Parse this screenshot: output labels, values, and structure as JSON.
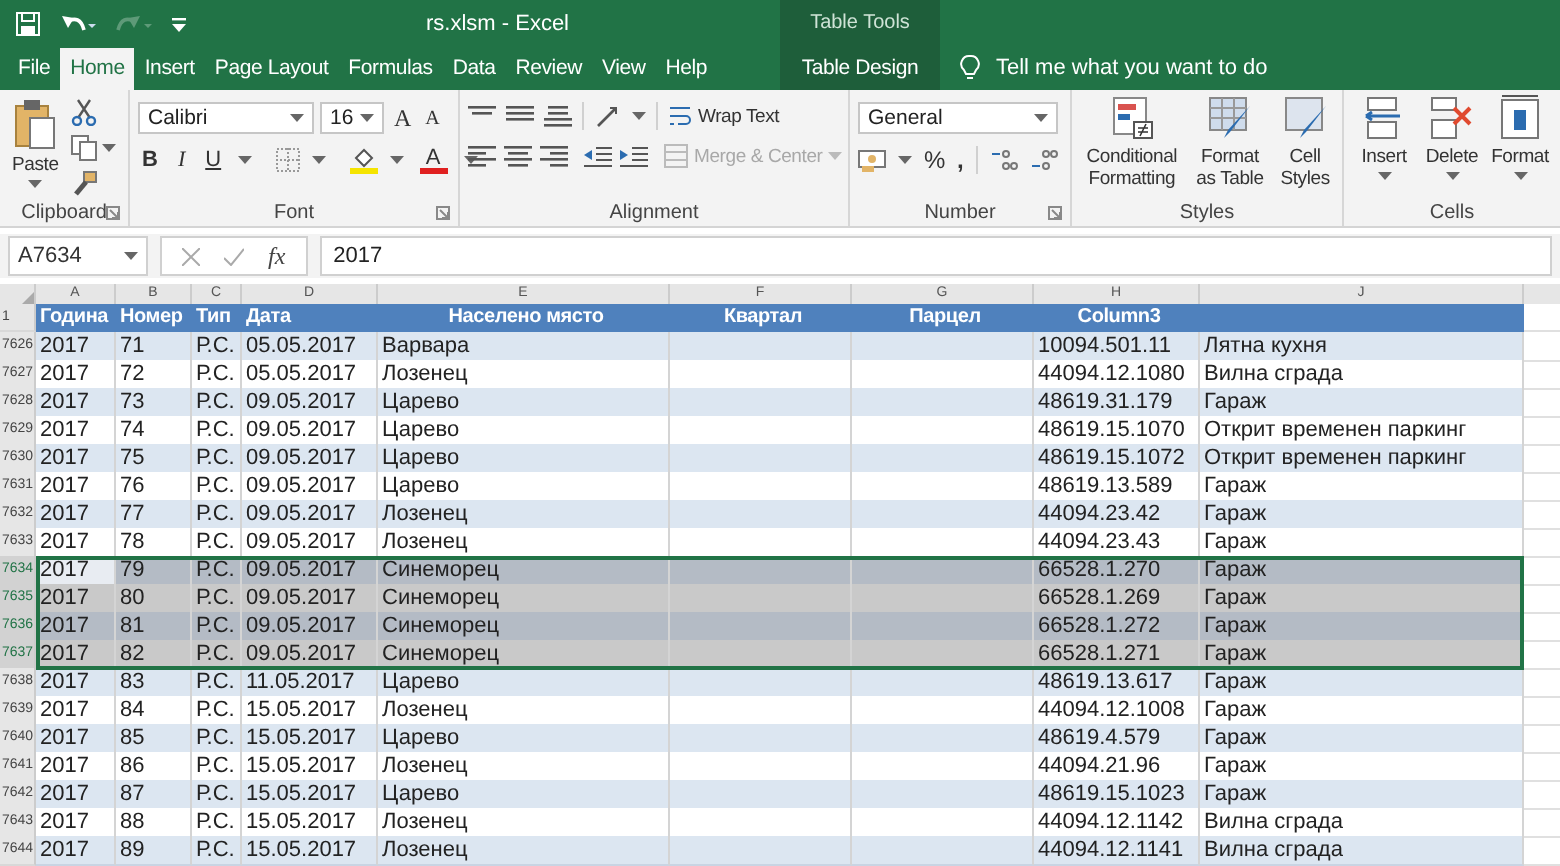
{
  "window": {
    "title": "rs.xlsm  -  Excel"
  },
  "context_tab_group": {
    "label": "Table Tools"
  },
  "tabs": [
    {
      "label": "File",
      "selected": false,
      "kind": "main"
    },
    {
      "label": "Home",
      "selected": true,
      "kind": "main"
    },
    {
      "label": "Insert",
      "selected": false,
      "kind": "main"
    },
    {
      "label": "Page Layout",
      "selected": false,
      "kind": "main"
    },
    {
      "label": "Formulas",
      "selected": false,
      "kind": "main"
    },
    {
      "label": "Data",
      "selected": false,
      "kind": "main"
    },
    {
      "label": "Review",
      "selected": false,
      "kind": "main"
    },
    {
      "label": "View",
      "selected": false,
      "kind": "main"
    },
    {
      "label": "Help",
      "selected": false,
      "kind": "main"
    },
    {
      "label": "Table Design",
      "selected": false,
      "kind": "contextual"
    }
  ],
  "tell_me": {
    "placeholder": "Tell me what you want to do"
  },
  "clipboard": {
    "label": "Clipboard",
    "paste": "Paste"
  },
  "font": {
    "label": "Font",
    "name": "Calibri",
    "size": "16",
    "grow": "A",
    "shrink": "A",
    "bold": "B",
    "italic": "I",
    "underline": "U",
    "font_color_button": "A"
  },
  "alignment": {
    "label": "Alignment",
    "wrap_text": "Wrap Text",
    "merge": {
      "label": "Merge & Center",
      "disabled": true
    }
  },
  "number": {
    "label": "Number",
    "format": "General",
    "percent": "%",
    "comma": ","
  },
  "styles": {
    "label": "Styles",
    "buttons": [
      "Conditional Formatting",
      "Format as Table",
      "Cell Styles"
    ]
  },
  "cells": {
    "label": "Cells",
    "buttons": [
      "Insert",
      "Delete",
      "Format"
    ]
  },
  "formula_bar": {
    "name_box": "A7634",
    "function_label": "fx",
    "value": "2017"
  },
  "column_letters": [
    "A",
    "B",
    "C",
    "D",
    "E",
    "F",
    "G",
    "H",
    "J"
  ],
  "header_row": {
    "row_number": "1",
    "cells": [
      "Година",
      "Номер",
      "Тип",
      "Дата",
      "Населено място",
      "Квартал",
      "Парцел",
      "Column3"
    ]
  },
  "rows": [
    {
      "row_number": "7626",
      "year": "2017",
      "number": "71",
      "type": "Р.С.",
      "date": "05.05.2017",
      "place": "Варвара",
      "column3": "10094.501.11",
      "column_j": "Лятна кухня",
      "selected": false
    },
    {
      "row_number": "7627",
      "year": "2017",
      "number": "72",
      "type": "Р.С.",
      "date": "05.05.2017",
      "place": "Лозенец",
      "column3": "44094.12.1080",
      "column_j": "Вилна сграда",
      "selected": false
    },
    {
      "row_number": "7628",
      "year": "2017",
      "number": "73",
      "type": "Р.С.",
      "date": "09.05.2017",
      "place": "Царево",
      "column3": "48619.31.179",
      "column_j": "Гараж",
      "selected": false
    },
    {
      "row_number": "7629",
      "year": "2017",
      "number": "74",
      "type": "Р.С.",
      "date": "09.05.2017",
      "place": "Царево",
      "column3": "48619.15.1070",
      "column_j": "Открит временен паркинг",
      "selected": false
    },
    {
      "row_number": "7630",
      "year": "2017",
      "number": "75",
      "type": "Р.С.",
      "date": "09.05.2017",
      "place": "Царево",
      "column3": "48619.15.1072",
      "column_j": "Открит временен паркинг",
      "selected": false
    },
    {
      "row_number": "7631",
      "year": "2017",
      "number": "76",
      "type": "Р.С.",
      "date": "09.05.2017",
      "place": "Царево",
      "column3": "48619.13.589",
      "column_j": "Гараж",
      "selected": false
    },
    {
      "row_number": "7632",
      "year": "2017",
      "number": "77",
      "type": "Р.С.",
      "date": "09.05.2017",
      "place": "Лозенец",
      "column3": "44094.23.42",
      "column_j": "Гараж",
      "selected": false
    },
    {
      "row_number": "7633",
      "year": "2017",
      "number": "78",
      "type": "Р.С.",
      "date": "09.05.2017",
      "place": "Лозенец",
      "column3": "44094.23.43",
      "column_j": "Гараж",
      "selected": false
    },
    {
      "row_number": "7634",
      "year": "2017",
      "number": "79",
      "type": "Р.С.",
      "date": "09.05.2017",
      "place": "Синеморец",
      "column3": "66528.1.270",
      "column_j": "Гараж",
      "selected": true
    },
    {
      "row_number": "7635",
      "year": "2017",
      "number": "80",
      "type": "Р.С.",
      "date": "09.05.2017",
      "place": "Синеморец",
      "column3": "66528.1.269",
      "column_j": "Гараж",
      "selected": true
    },
    {
      "row_number": "7636",
      "year": "2017",
      "number": "81",
      "type": "Р.С.",
      "date": "09.05.2017",
      "place": "Синеморец",
      "column3": "66528.1.272",
      "column_j": "Гараж",
      "selected": true
    },
    {
      "row_number": "7637",
      "year": "2017",
      "number": "82",
      "type": "Р.С.",
      "date": "09.05.2017",
      "place": "Синеморец",
      "column3": "66528.1.271",
      "column_j": "Гараж",
      "selected": true
    },
    {
      "row_number": "7638",
      "year": "2017",
      "number": "83",
      "type": "Р.С.",
      "date": "11.05.2017",
      "place": "Царево",
      "column3": "48619.13.617",
      "column_j": "Гараж",
      "selected": false
    },
    {
      "row_number": "7639",
      "year": "2017",
      "number": "84",
      "type": "Р.С.",
      "date": "15.05.2017",
      "place": "Лозенец",
      "column3": "44094.12.1008",
      "column_j": "Гараж",
      "selected": false
    },
    {
      "row_number": "7640",
      "year": "2017",
      "number": "85",
      "type": "Р.С.",
      "date": "15.05.2017",
      "place": "Царево",
      "column3": "48619.4.579",
      "column_j": "Гараж",
      "selected": false
    },
    {
      "row_number": "7641",
      "year": "2017",
      "number": "86",
      "type": "Р.С.",
      "date": "15.05.2017",
      "place": "Лозенец",
      "column3": "44094.21.96",
      "column_j": "Гараж",
      "selected": false
    },
    {
      "row_number": "7642",
      "year": "2017",
      "number": "87",
      "type": "Р.С.",
      "date": "15.05.2017",
      "place": "Царево",
      "column3": "48619.15.1023",
      "column_j": "Гараж",
      "selected": false
    },
    {
      "row_number": "7643",
      "year": "2017",
      "number": "88",
      "type": "Р.С.",
      "date": "15.05.2017",
      "place": "Лозенец",
      "column3": "44094.12.1142",
      "column_j": "Вилна сграда",
      "selected": false
    },
    {
      "row_number": "7644",
      "year": "2017",
      "number": "89",
      "type": "Р.С.",
      "date": "15.05.2017",
      "place": "Лозенец",
      "column3": "44094.12.1141",
      "column_j": "Вилна сграда",
      "selected": false
    }
  ]
}
